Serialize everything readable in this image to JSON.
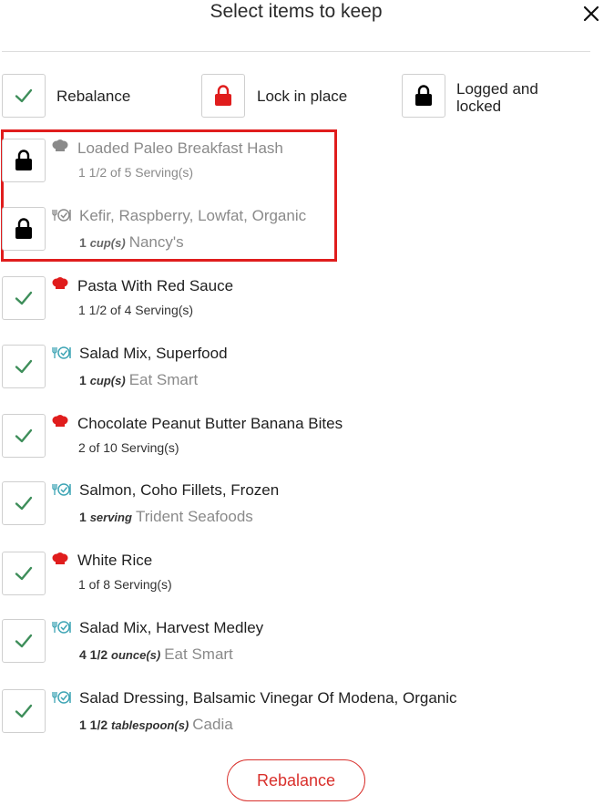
{
  "header": {
    "title": "Select items to keep"
  },
  "legend": [
    {
      "label": "Rebalance"
    },
    {
      "label": "Lock in place"
    },
    {
      "label_line1": "Logged and",
      "label_line2": "locked"
    }
  ],
  "items": [
    {
      "name": "Loaded Paleo Breakfast Hash",
      "sub": "1 1/2 of 5 Serving(s)"
    },
    {
      "name": "Kefir, Raspberry, Lowfat, Organic",
      "qty": "1",
      "unit": "cup(s)",
      "brand": "Nancy's"
    },
    {
      "name": "Pasta With Red Sauce",
      "sub": "1 1/2 of 4 Serving(s)"
    },
    {
      "name": "Salad Mix, Superfood",
      "qty": "1",
      "unit": "cup(s)",
      "brand": "Eat Smart"
    },
    {
      "name": "Chocolate Peanut Butter Banana Bites",
      "sub": "2 of 10 Serving(s)"
    },
    {
      "name": "Salmon, Coho Fillets, Frozen",
      "qty": "1",
      "unit": "serving",
      "brand": "Trident Seafoods"
    },
    {
      "name": "White Rice",
      "sub": "1 of 8 Serving(s)"
    },
    {
      "name": "Salad Mix, Harvest Medley",
      "qty": "4 1/2",
      "unit": "ounce(s)",
      "brand": "Eat Smart"
    },
    {
      "name": "Salad Dressing, Balsamic Vinegar Of Modena, Organic",
      "qty": "1 1/2",
      "unit": "tablespoon(s)",
      "brand": "Cadia"
    }
  ],
  "footer": {
    "button_label": "Rebalance"
  },
  "colors": {
    "accent_red": "#e01d1d",
    "check_green": "#3e8e5a",
    "food_teal": "#3fa5b5",
    "button_red": "#d9302c"
  }
}
